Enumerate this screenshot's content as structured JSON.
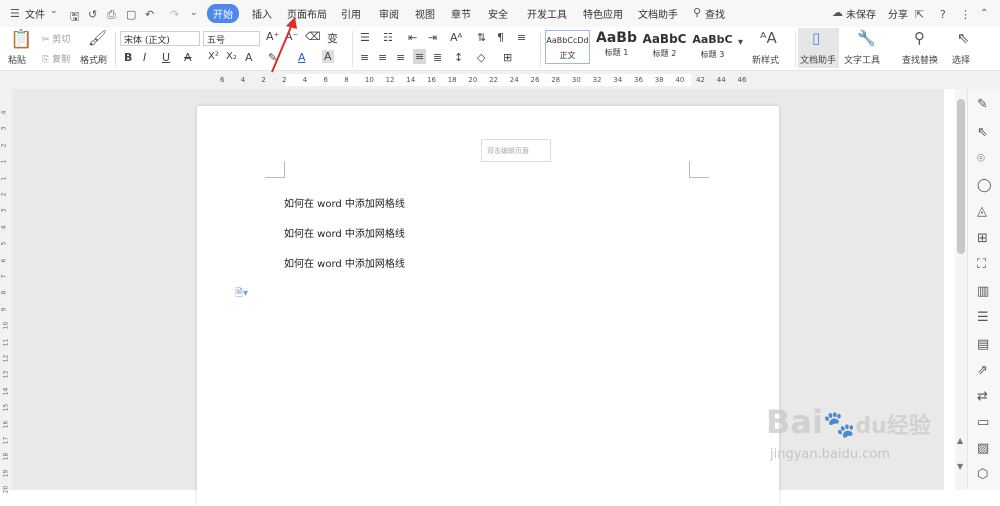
{
  "menubar": {
    "file": "文件",
    "tabs": [
      "开始",
      "插入",
      "页面布局",
      "引用",
      "审阅",
      "视图",
      "章节",
      "安全",
      "开发工具",
      "特色应用",
      "文档助手"
    ],
    "search": "查找",
    "unsaved": "未保存",
    "share": "分享"
  },
  "ribbon": {
    "paste": "粘贴",
    "cut": "剪切",
    "copy": "复制",
    "format_painter": "格式刷",
    "font_name": "宋体 (正文)",
    "font_size": "五号",
    "styles": [
      {
        "preview": "AaBbCcDd",
        "label": "正文"
      },
      {
        "preview": "AaBb",
        "label": "标题 1"
      },
      {
        "preview": "AaBbC",
        "label": "标题 2"
      },
      {
        "preview": "AaBbC",
        "label": "标题 3"
      }
    ],
    "new_style": "新样式",
    "doc_assistant": "文档助手",
    "text_tools": "文字工具",
    "find_replace": "查找替换",
    "select": "选择"
  },
  "ruler": {
    "ticks": [
      "6",
      "4",
      "2",
      "2",
      "4",
      "6",
      "8",
      "10",
      "12",
      "14",
      "16",
      "18",
      "20",
      "22",
      "24",
      "26",
      "28",
      "30",
      "32",
      "34",
      "36",
      "38",
      "40",
      "42",
      "44",
      "46"
    ]
  },
  "document": {
    "header_hint": "双击编辑页眉",
    "lines": [
      "如何在 word 中添加网格线",
      "如何在 word 中添加网格线",
      "如何在 word 中添加网格线"
    ]
  },
  "watermark": {
    "brand": "Bai",
    "brand2": "经验",
    "url": "jingyan.baidu.com"
  }
}
